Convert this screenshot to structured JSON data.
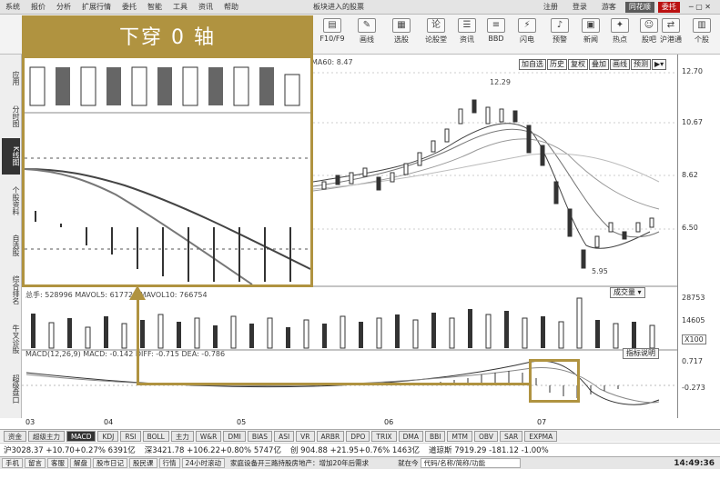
{
  "menubar": {
    "items": [
      "系统",
      "报价",
      "分析",
      "扩展行情",
      "委托",
      "智能",
      "工具",
      "资讯",
      "帮助"
    ],
    "center_text": "板块进入的股票",
    "right_items": [
      "注册",
      "登录",
      "游客"
    ],
    "buttons": [
      "同花顺",
      "委托"
    ]
  },
  "toolbar": {
    "buttons": [
      {
        "label": "F10/F9",
        "icon": "f10-icon"
      },
      {
        "label": "画线",
        "icon": "pencil-icon"
      },
      {
        "label": "选股",
        "icon": "filter-icon"
      },
      {
        "label": "论股堂",
        "icon": "chat-icon"
      },
      {
        "label": "资讯",
        "icon": "news-icon"
      },
      {
        "label": "BBD",
        "icon": "bbd-icon"
      },
      {
        "label": "闪电",
        "icon": "flash-icon"
      },
      {
        "label": "预警",
        "icon": "bell-icon"
      },
      {
        "label": "新闻",
        "icon": "newspaper-icon"
      },
      {
        "label": "热点",
        "icon": "hot-icon"
      },
      {
        "label": "股吧",
        "icon": "forum-icon"
      },
      {
        "label": "沪港通",
        "icon": "link-icon"
      },
      {
        "label": "个股",
        "icon": "stock-icon"
      }
    ]
  },
  "sidebar": {
    "items": [
      "应用",
      "分时图",
      "K线图",
      "个股资料",
      "自选股",
      "综合排名",
      "牛叉诊股",
      "超级盘口"
    ],
    "active": "K线图"
  },
  "main_chart": {
    "ma_legend": "MA60: 8.47",
    "price_high_label": "12.29",
    "price_low_label": "5.95",
    "tools": [
      "加自选",
      "历史",
      "复权",
      "叠加",
      "画线",
      "预测"
    ],
    "y_labels": [
      "12.70",
      "10.67",
      "8.62",
      "6.50"
    ]
  },
  "overlay": {
    "title": "下穿 0 轴"
  },
  "volume": {
    "legend": "总手: 528996  MAVOL5: 617723  MAVOL10: 766754",
    "dropdown": "成交量",
    "y_labels": [
      "28753",
      "14605",
      "X100"
    ]
  },
  "macd": {
    "legend": "MACD(12,26,9)  MACD: -0.142  DIFF: -0.715  DEA: -0.786",
    "button": "指标说明",
    "y_labels": [
      "0.717",
      "-0.273"
    ]
  },
  "xaxis": {
    "labels": [
      "03",
      "04",
      "05",
      "06",
      "07"
    ]
  },
  "tabs": {
    "items": [
      "资金",
      "超级主力",
      "MACD",
      "KDJ",
      "RSI",
      "BOLL",
      "主力",
      "W&R",
      "DMI",
      "BIAS",
      "ASI",
      "VR",
      "ARBR",
      "DPO",
      "TRIX",
      "DMA",
      "BBI",
      "MTM",
      "OBV",
      "SAR",
      "EXPMA"
    ],
    "active": "MACD"
  },
  "ticker": {
    "items": [
      "沪3028.37 +10.70+0.27% 6391亿",
      "深3421.78 +106.22+0.80% 5747亿",
      "创 904.88 +21.95+0.76% 1463亿",
      "道琼斯 7919.29 -181.12 -1.00%"
    ]
  },
  "statusbar": {
    "tabs": [
      "手机",
      "留言",
      "客服",
      "解盘",
      "股市日记",
      "股民课",
      "行情",
      "24小时滚动"
    ],
    "news": "家庭设备开三路持股房地产：增加20年后需求",
    "search_label": "就在今",
    "search_hint": "代码/名称/简称/功能",
    "clock": "14:49:36"
  },
  "chart_data": {
    "type": "line",
    "title": "",
    "series": [
      {
        "name": "DIFF",
        "description": "faster curve crossing down through 0 axis"
      },
      {
        "name": "DEA",
        "description": "slower curve crossing down through 0 axis"
      }
    ],
    "macd_value": -0.142,
    "diff_value": -0.715,
    "dea_value": -0.786,
    "y_ticks": [
      0.717,
      -0.273
    ]
  }
}
